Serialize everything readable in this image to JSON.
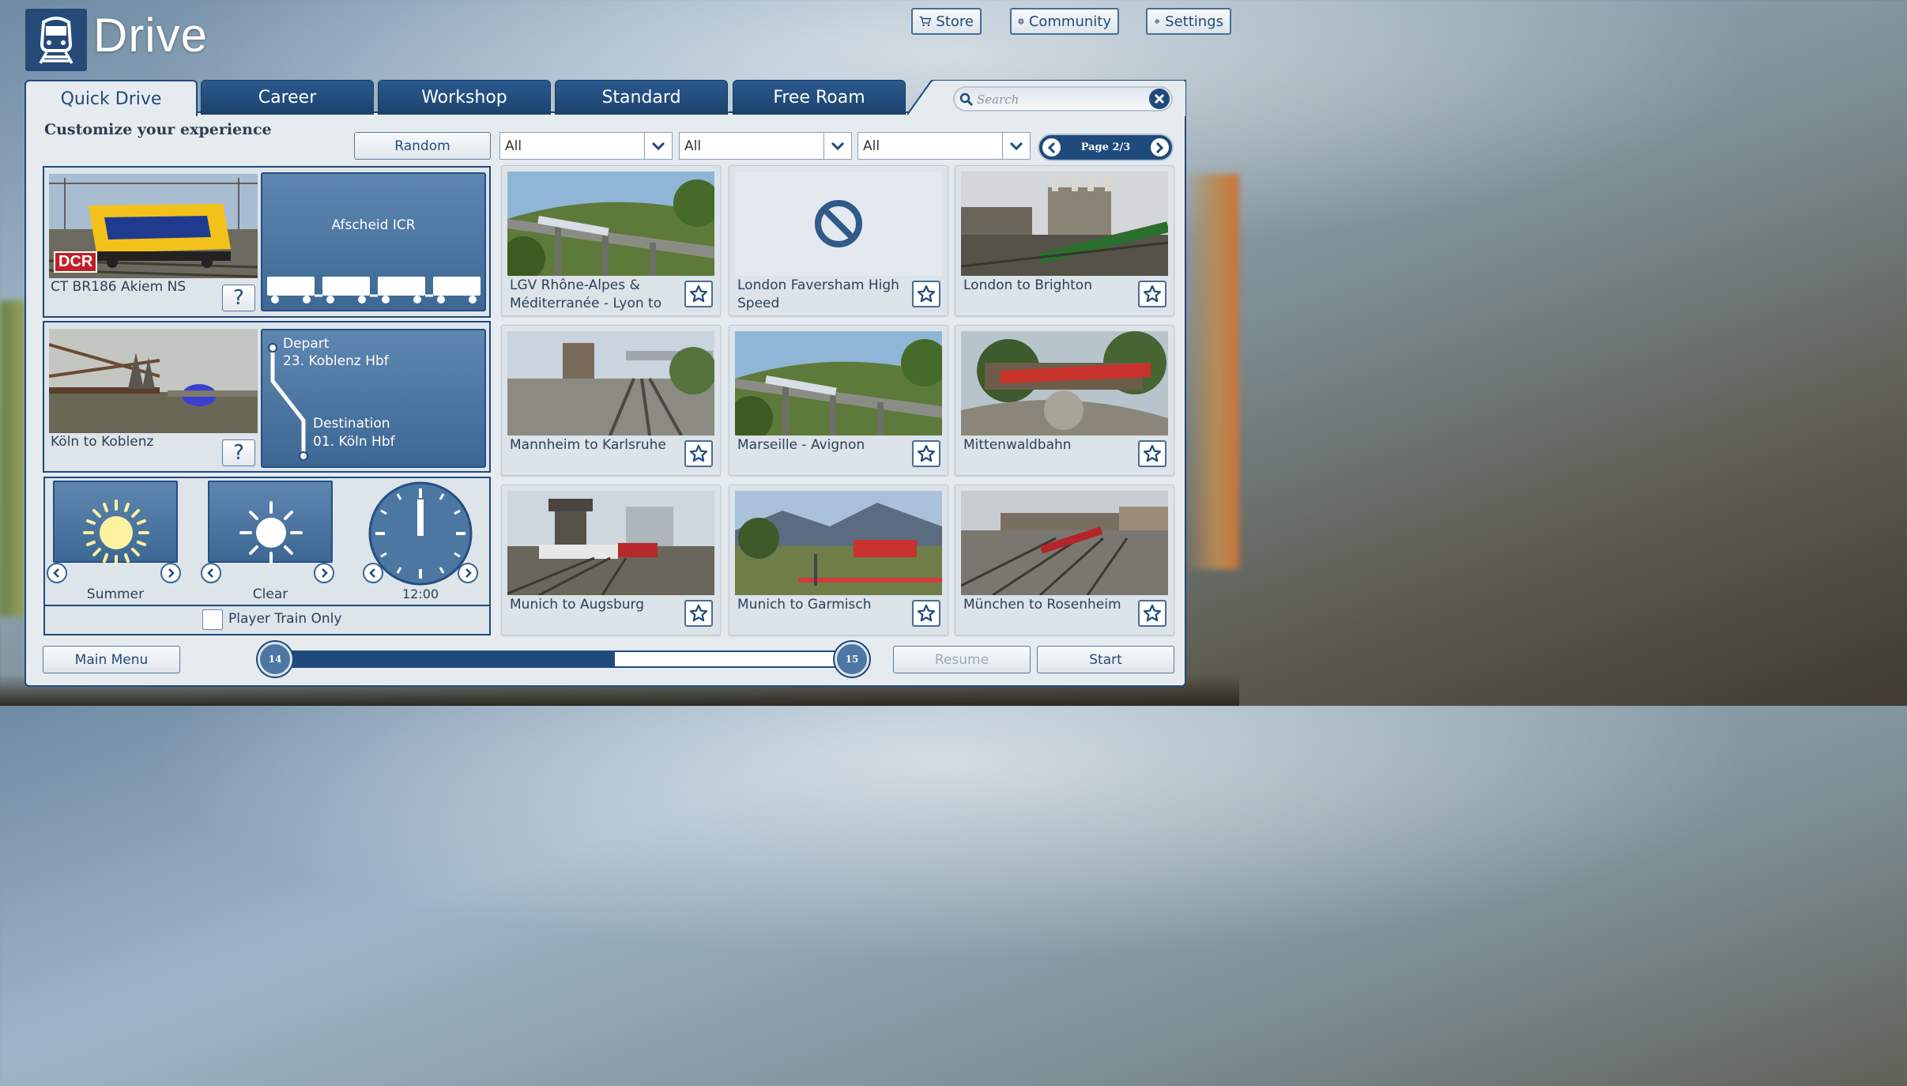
{
  "app": {
    "title": "Drive"
  },
  "top_buttons": {
    "store": "Store",
    "community": "Community",
    "settings": "Settings"
  },
  "tabs": [
    {
      "label": "Quick Drive",
      "active": true
    },
    {
      "label": "Career",
      "active": false
    },
    {
      "label": "Workshop",
      "active": false
    },
    {
      "label": "Standard",
      "active": false
    },
    {
      "label": "Free Roam",
      "active": false
    }
  ],
  "search": {
    "placeholder": "Search"
  },
  "heading": "Customize your experience",
  "filters": {
    "random_label": "Random",
    "dropdowns": [
      "All",
      "All",
      "All"
    ]
  },
  "pager": {
    "label": "Page 2/3"
  },
  "loco": {
    "name": "CT BR186 Akiem NS",
    "badge": "DCR",
    "consist": "Afscheid ICR",
    "help": "?"
  },
  "route_selection": {
    "name": "Köln to Koblenz",
    "help": "?",
    "depart_label": "Depart",
    "depart_value": "23. Koblenz Hbf",
    "destination_label": "Destination",
    "destination_value": "01. Köln Hbf"
  },
  "conditions": {
    "season": "Summer",
    "weather": "Clear",
    "time": "12:00",
    "player_train_only": "Player Train Only",
    "player_train_only_checked": false
  },
  "routes": [
    {
      "name": "LGV Rhône-Alpes & Méditerranée - Lyon to",
      "scene": "viaduct"
    },
    {
      "name": "London Faversham High Speed",
      "scene": "none"
    },
    {
      "name": "London to Brighton",
      "scene": "city"
    },
    {
      "name": "Mannheim to Karlsruhe",
      "scene": "station"
    },
    {
      "name": "Marseille - Avignon",
      "scene": "viaduct"
    },
    {
      "name": "Mittenwaldbahn",
      "scene": "mountain"
    },
    {
      "name": "Munich to Augsburg",
      "scene": "tower"
    },
    {
      "name": "Munich to Garmisch",
      "scene": "crossing"
    },
    {
      "name": "München to Rosenheim",
      "scene": "yard"
    }
  ],
  "progress": {
    "start": "14",
    "end": "15",
    "fraction": 0.59
  },
  "bottom_buttons": {
    "main_menu": "Main Menu",
    "resume": "Resume",
    "start": "Start"
  },
  "colors": {
    "primary": "#1f4a7c",
    "panel": "#e6ebf0",
    "card_blue": "#4c77a3"
  }
}
